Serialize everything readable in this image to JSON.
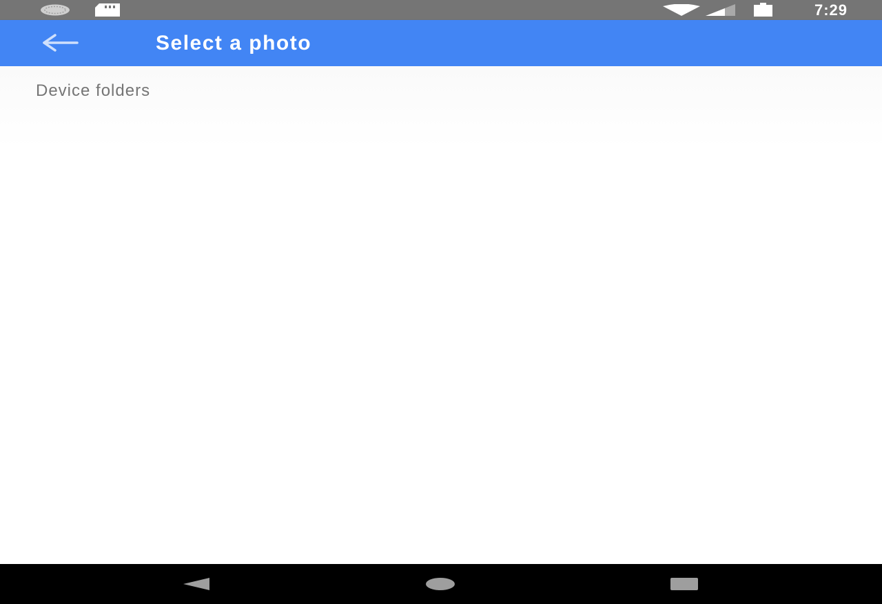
{
  "status_bar": {
    "time": "7:29",
    "icons": [
      "sync-icon",
      "sd-card-icon",
      "wifi-icon",
      "signal-icon",
      "battery-icon"
    ]
  },
  "app_bar": {
    "title": "Select a photo",
    "back_icon": "arrow-back-icon",
    "color": "#4285f4"
  },
  "content": {
    "section_header": "Device folders"
  },
  "nav_bar": {
    "buttons": [
      "back-triangle-icon",
      "home-circle-icon",
      "recents-square-icon"
    ]
  }
}
